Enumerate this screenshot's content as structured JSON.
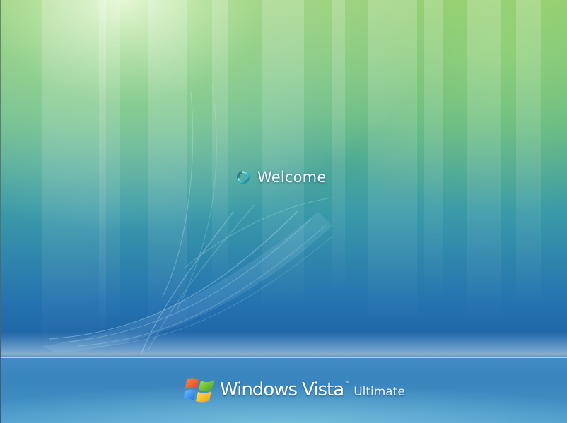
{
  "welcome": {
    "text": "Welcome",
    "icon": "busy-spinner-icon"
  },
  "branding": {
    "logo_icon": "windows-flag-icon",
    "product": "Windows",
    "name": "Vista",
    "trademark": "™",
    "edition": "Ultimate"
  },
  "colors": {
    "top_green": "#8fcf70",
    "mid_teal": "#3a9aa8",
    "bottom_blue": "#1a5a9a",
    "horizon_highlight": "#9fd6f5"
  }
}
